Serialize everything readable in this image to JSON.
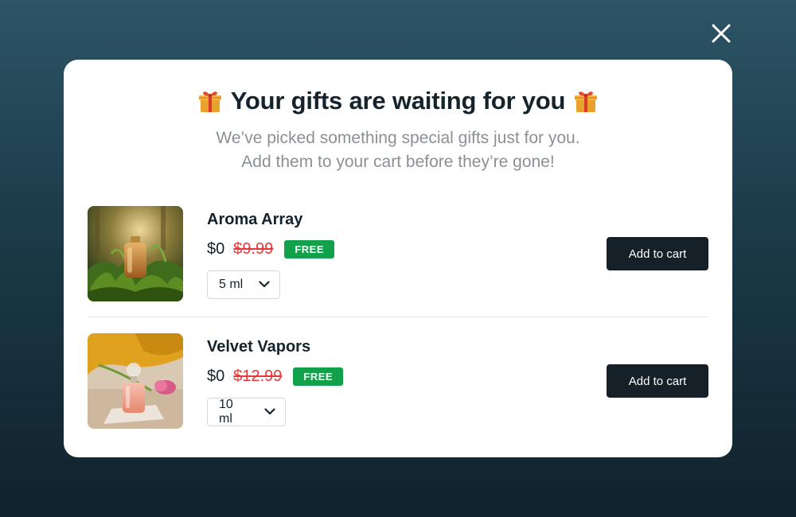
{
  "close_icon": "close-icon",
  "modal": {
    "title": "Your gifts are waiting for you",
    "gift_icon": "gift-icon",
    "subtitle_line1": "We’ve picked something special gifts just for you.",
    "subtitle_line2": "Add them to your cart before they’re gone!"
  },
  "products": [
    {
      "name": "Aroma Array",
      "price": "$0",
      "original_price": "$9.99",
      "badge": "FREE",
      "size": "5 ml",
      "button": "Add to cart"
    },
    {
      "name": "Velvet Vapors",
      "price": "$0",
      "original_price": "$12.99",
      "badge": "FREE",
      "size": "10 ml",
      "button": "Add to cart"
    }
  ],
  "colors": {
    "accent_dark": "#152028",
    "badge_green": "#12a14b",
    "strike_red": "#e63939"
  }
}
